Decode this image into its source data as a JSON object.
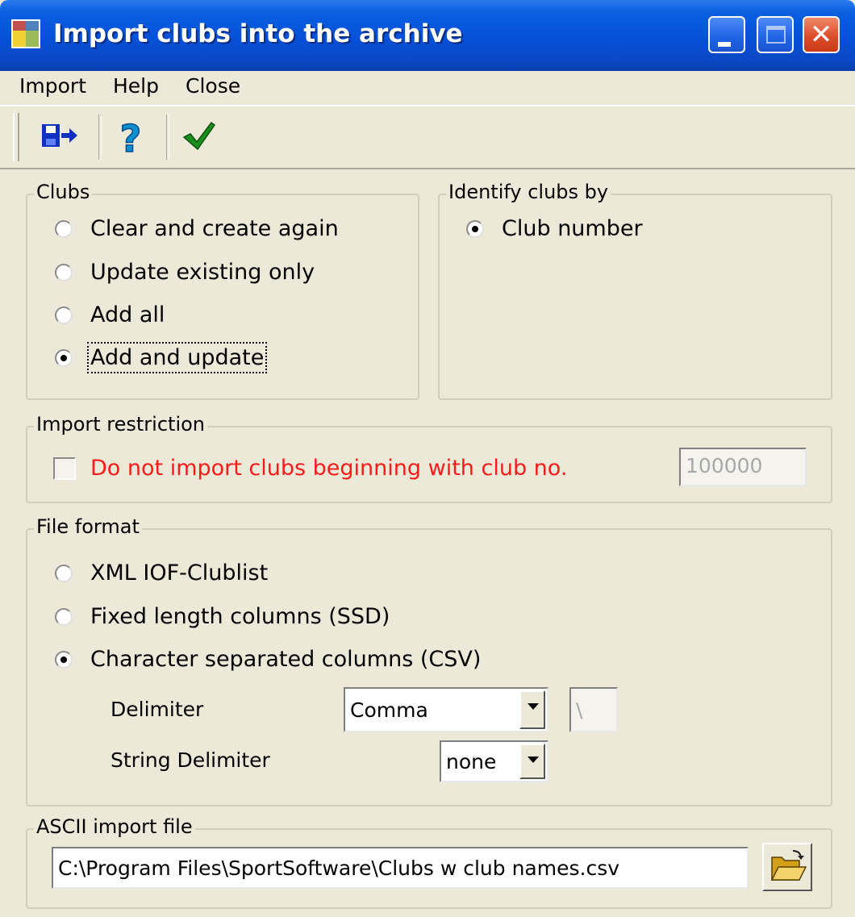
{
  "window": {
    "title": "Import clubs into the archive"
  },
  "menu": {
    "items": [
      "Import",
      "Help",
      "Close"
    ]
  },
  "clubs": {
    "legend": "Clubs",
    "options": [
      "Clear and create again",
      "Update existing only",
      "Add all",
      "Add and update"
    ],
    "selected": "Add and update"
  },
  "identify": {
    "legend": "Identify clubs by",
    "options": [
      "Club number"
    ],
    "selected": "Club number"
  },
  "restriction": {
    "legend": "Import restriction",
    "checkbox_label": "Do not import clubs beginning with club no.",
    "checked": false,
    "club_no": "100000",
    "label_color": "#ff1a1a"
  },
  "file_format": {
    "legend": "File format",
    "options": [
      "XML IOF-Clublist",
      "Fixed length columns (SSD)",
      "Character separated columns (CSV)"
    ],
    "selected": "Character separated columns (CSV)",
    "delimiter_label": "Delimiter",
    "delimiter_value": "Comma",
    "delimiter_char": "\\",
    "string_delimiter_label": "String Delimiter",
    "string_delimiter_value": "none"
  },
  "ascii_file": {
    "legend": "ASCII import file",
    "path": "C:\\Program Files\\SportSoftware\\Clubs w club names.csv"
  },
  "icons": {
    "app": "app-window-icon",
    "toolbar": [
      "save-import-icon",
      "help-icon",
      "checkmark-icon"
    ],
    "browse": "open-folder-icon"
  },
  "colors": {
    "titlebar": "#0650d8",
    "face": "#ece9d8",
    "close_button": "#de4c2a"
  }
}
